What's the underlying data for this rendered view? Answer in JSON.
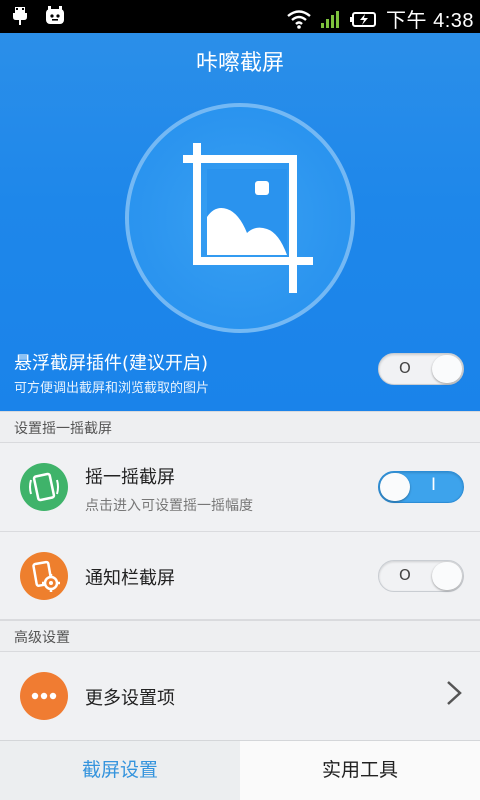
{
  "status_bar": {
    "time": "下午 4:38",
    "icons": [
      "usb-icon",
      "robot-icon",
      "wifi-icon",
      "signal-icon",
      "battery-charging-icon"
    ]
  },
  "header": {
    "title": "咔嚓截屏"
  },
  "floating_plugin": {
    "title": "悬浮截屏插件(建议开启)",
    "subtitle": "可方便调出截屏和浏览截取的图片",
    "toggle_mark": "O"
  },
  "shake_section": {
    "header": "设置摇一摇截屏",
    "shake_row": {
      "title": "摇一摇截屏",
      "subtitle": "点击进入可设置摇一摇幅度",
      "toggle_mark": "I"
    },
    "notify_row": {
      "title": "通知栏截屏",
      "toggle_mark": "O"
    }
  },
  "advanced_section": {
    "header": "高级设置",
    "more_row": {
      "title": "更多设置项"
    }
  },
  "tabs": {
    "screenshot_settings": "截屏设置",
    "tools": "实用工具"
  },
  "colors": {
    "hero_blue": "#1e87ea",
    "shake_green": "#3fb36a",
    "notify_orange": "#ee7f2d",
    "more_orange": "#f07c32",
    "active_tab": "#3594dd"
  }
}
